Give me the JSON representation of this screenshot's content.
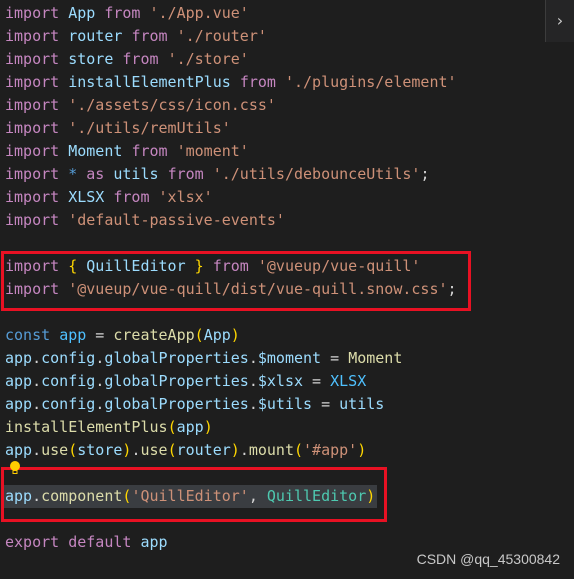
{
  "editor": {
    "nav_button_icon": "chevron-right-icon",
    "lines": [
      [
        [
          "k",
          "import"
        ],
        [
          "p",
          " "
        ],
        [
          "v",
          "App"
        ],
        [
          "p",
          " "
        ],
        [
          "k",
          "from"
        ],
        [
          "p",
          " "
        ],
        [
          "s",
          "'./App.vue'"
        ]
      ],
      [
        [
          "k",
          "import"
        ],
        [
          "p",
          " "
        ],
        [
          "v",
          "router"
        ],
        [
          "p",
          " "
        ],
        [
          "k",
          "from"
        ],
        [
          "p",
          " "
        ],
        [
          "s",
          "'./router'"
        ]
      ],
      [
        [
          "k",
          "import"
        ],
        [
          "p",
          " "
        ],
        [
          "v",
          "store"
        ],
        [
          "p",
          " "
        ],
        [
          "k",
          "from"
        ],
        [
          "p",
          " "
        ],
        [
          "s",
          "'./store'"
        ]
      ],
      [
        [
          "k",
          "import"
        ],
        [
          "p",
          " "
        ],
        [
          "v",
          "installElementPlus"
        ],
        [
          "p",
          " "
        ],
        [
          "k",
          "from"
        ],
        [
          "p",
          " "
        ],
        [
          "s",
          "'./plugins/element'"
        ]
      ],
      [
        [
          "k",
          "import"
        ],
        [
          "p",
          " "
        ],
        [
          "s",
          "'./assets/css/icon.css'"
        ]
      ],
      [
        [
          "k",
          "import"
        ],
        [
          "p",
          " "
        ],
        [
          "s",
          "'./utils/remUtils'"
        ]
      ],
      [
        [
          "k",
          "import"
        ],
        [
          "p",
          " "
        ],
        [
          "v",
          "Moment"
        ],
        [
          "p",
          " "
        ],
        [
          "k",
          "from"
        ],
        [
          "p",
          " "
        ],
        [
          "s",
          "'moment'"
        ]
      ],
      [
        [
          "k",
          "import"
        ],
        [
          "p",
          " "
        ],
        [
          "c",
          "*"
        ],
        [
          "p",
          " "
        ],
        [
          "k",
          "as"
        ],
        [
          "p",
          " "
        ],
        [
          "v",
          "utils"
        ],
        [
          "p",
          " "
        ],
        [
          "k",
          "from"
        ],
        [
          "p",
          " "
        ],
        [
          "s",
          "'./utils/debounceUtils'"
        ],
        [
          "p",
          ";"
        ]
      ],
      [
        [
          "k",
          "import"
        ],
        [
          "p",
          " "
        ],
        [
          "v",
          "XLSX"
        ],
        [
          "p",
          " "
        ],
        [
          "k",
          "from"
        ],
        [
          "p",
          " "
        ],
        [
          "s",
          "'xlsx'"
        ]
      ],
      [
        [
          "k",
          "import"
        ],
        [
          "p",
          " "
        ],
        [
          "s",
          "'default-passive-events'"
        ]
      ],
      [],
      [
        [
          "k",
          "import"
        ],
        [
          "p",
          " "
        ],
        [
          "b",
          "{"
        ],
        [
          "p",
          " "
        ],
        [
          "v",
          "QuillEditor"
        ],
        [
          "p",
          " "
        ],
        [
          "b",
          "}"
        ],
        [
          "p",
          " "
        ],
        [
          "k",
          "from"
        ],
        [
          "p",
          " "
        ],
        [
          "s",
          "'@vueup/vue-quill'"
        ]
      ],
      [
        [
          "k",
          "import"
        ],
        [
          "p",
          " "
        ],
        [
          "s",
          "'@vueup/vue-quill/dist/vue-quill.snow.css'"
        ],
        [
          "p",
          ";"
        ]
      ],
      [],
      [
        [
          "c",
          "const"
        ],
        [
          "p",
          " "
        ],
        [
          "n",
          "app"
        ],
        [
          "p",
          " = "
        ],
        [
          "f",
          "createApp"
        ],
        [
          "b",
          "("
        ],
        [
          "v",
          "App"
        ],
        [
          "b",
          ")"
        ]
      ],
      [
        [
          "v",
          "app"
        ],
        [
          "p",
          "."
        ],
        [
          "v",
          "config"
        ],
        [
          "p",
          "."
        ],
        [
          "v",
          "globalProperties"
        ],
        [
          "p",
          "."
        ],
        [
          "v",
          "$moment"
        ],
        [
          "p",
          " = "
        ],
        [
          "f",
          "Moment"
        ]
      ],
      [
        [
          "v",
          "app"
        ],
        [
          "p",
          "."
        ],
        [
          "v",
          "config"
        ],
        [
          "p",
          "."
        ],
        [
          "v",
          "globalProperties"
        ],
        [
          "p",
          "."
        ],
        [
          "v",
          "$xlsx"
        ],
        [
          "p",
          " = "
        ],
        [
          "n",
          "XLSX"
        ]
      ],
      [
        [
          "v",
          "app"
        ],
        [
          "p",
          "."
        ],
        [
          "v",
          "config"
        ],
        [
          "p",
          "."
        ],
        [
          "v",
          "globalProperties"
        ],
        [
          "p",
          "."
        ],
        [
          "v",
          "$utils"
        ],
        [
          "p",
          " = "
        ],
        [
          "v",
          "utils"
        ]
      ],
      [
        [
          "f",
          "installElementPlus"
        ],
        [
          "b",
          "("
        ],
        [
          "v",
          "app"
        ],
        [
          "b",
          ")"
        ]
      ],
      [
        [
          "v",
          "app"
        ],
        [
          "p",
          "."
        ],
        [
          "f",
          "use"
        ],
        [
          "b",
          "("
        ],
        [
          "v",
          "store"
        ],
        [
          "b",
          ")"
        ],
        [
          "p",
          "."
        ],
        [
          "f",
          "use"
        ],
        [
          "b",
          "("
        ],
        [
          "v",
          "router"
        ],
        [
          "b",
          ")"
        ],
        [
          "p",
          "."
        ],
        [
          "f",
          "mount"
        ],
        [
          "b",
          "("
        ],
        [
          "s",
          "'#app'"
        ],
        [
          "b",
          ")"
        ]
      ],
      [],
      [
        [
          "v",
          "app"
        ],
        [
          "p",
          "."
        ],
        [
          "f",
          "component"
        ],
        [
          "b",
          "("
        ],
        [
          "s",
          "'QuillEditor'"
        ],
        [
          "p",
          ", "
        ],
        [
          "t",
          "QuillEditor"
        ],
        [
          "b",
          ")"
        ]
      ],
      [],
      [
        [
          "k",
          "export"
        ],
        [
          "p",
          " "
        ],
        [
          "k",
          "default"
        ],
        [
          "p",
          " "
        ],
        [
          "v",
          "app"
        ]
      ]
    ],
    "selected_line": 21,
    "lightbulb_icon": "lightbulb-icon",
    "highlight_color": "#e81123"
  },
  "watermark": "CSDN @qq_45300842"
}
